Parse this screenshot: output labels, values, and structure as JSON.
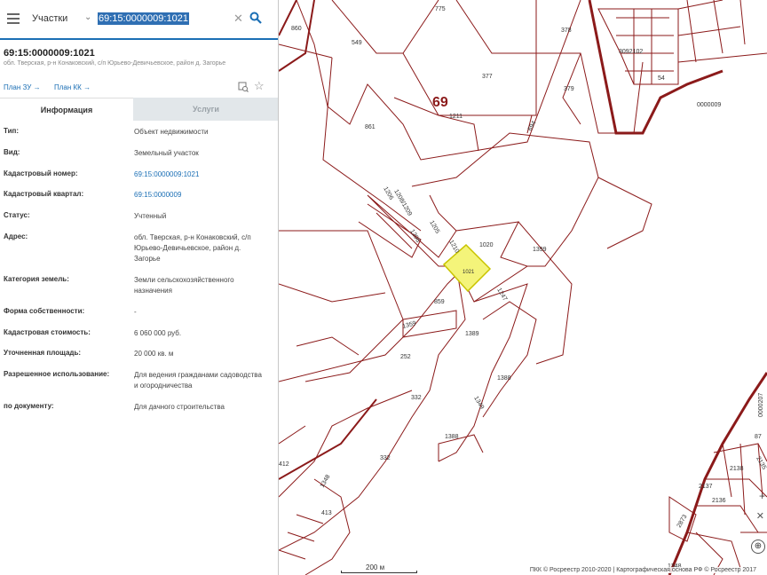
{
  "search": {
    "type_label": "Участки",
    "value": "69:15:0000009:1021"
  },
  "object": {
    "title": "69:15:0000009:1021",
    "subtitle": "обл. Тверская, р-н Конаковский, с/п Юрьево-Девичьевское, район д. Загорье"
  },
  "links": {
    "plan_zu": "План ЗУ",
    "plan_kk": "План КК"
  },
  "tabs": {
    "info": "Информация",
    "services": "Услуги"
  },
  "properties": [
    {
      "label": "Тип:",
      "value": "Объект недвижимости"
    },
    {
      "label": "Вид:",
      "value": "Земельный участок"
    },
    {
      "label": "Кадастровый номер:",
      "value": "69:15:0000009:1021"
    },
    {
      "label": "Кадастровый квартал:",
      "value": "69:15:0000009"
    },
    {
      "label": "Статус:",
      "value": "Учтенный"
    },
    {
      "label": "Адрес:",
      "value": "обл. Тверская, р-н Конаковский, с/п Юрьево-Девичьевское, район д. Загорье"
    },
    {
      "label": "Категория земель:",
      "value": "Земли сельскохозяйственного назначения"
    },
    {
      "label": "Форма собственности:",
      "value": "-"
    },
    {
      "label": "Кадастровая стоимость:",
      "value": "6 060 000 руб."
    },
    {
      "label": "Уточненная площадь:",
      "value": "20 000 кв. м"
    },
    {
      "label": "Разрешенное использование:",
      "value": "Для ведения гражданами садоводства и огородничества"
    },
    {
      "label": "по документу:",
      "value": "Для дачного строительства"
    }
  ],
  "map": {
    "quarter_label": "69",
    "highlight_color": "#f4f47a",
    "boundary_color": "#8b1a1a",
    "scale_label": "200 м",
    "attribution": "ПКК © Росреестр 2010-2020 | Картографическая основа РФ © Росреестр 2017",
    "labels": [
      "775",
      "860",
      "549",
      "378",
      "377",
      "379",
      "54",
      "1211",
      "861",
      "694",
      "0000009",
      "3092102",
      "1206",
      "1208",
      "1209",
      "1210",
      "1205",
      "1020",
      "1399",
      "1021",
      "1247",
      "859",
      "1389",
      "252",
      "1359",
      "1388",
      "1349",
      "332",
      "332",
      "1388",
      "412",
      "1348",
      "413",
      "2137",
      "2136",
      "2138",
      "87",
      "2135",
      "2873",
      "1348",
      "0000207"
    ]
  },
  "icons": {
    "menu": "menu-icon",
    "search": "search-icon",
    "clear": "close-icon",
    "collapse": "chevron-left-icon",
    "star": "star-icon",
    "plan": "plan-icon"
  }
}
